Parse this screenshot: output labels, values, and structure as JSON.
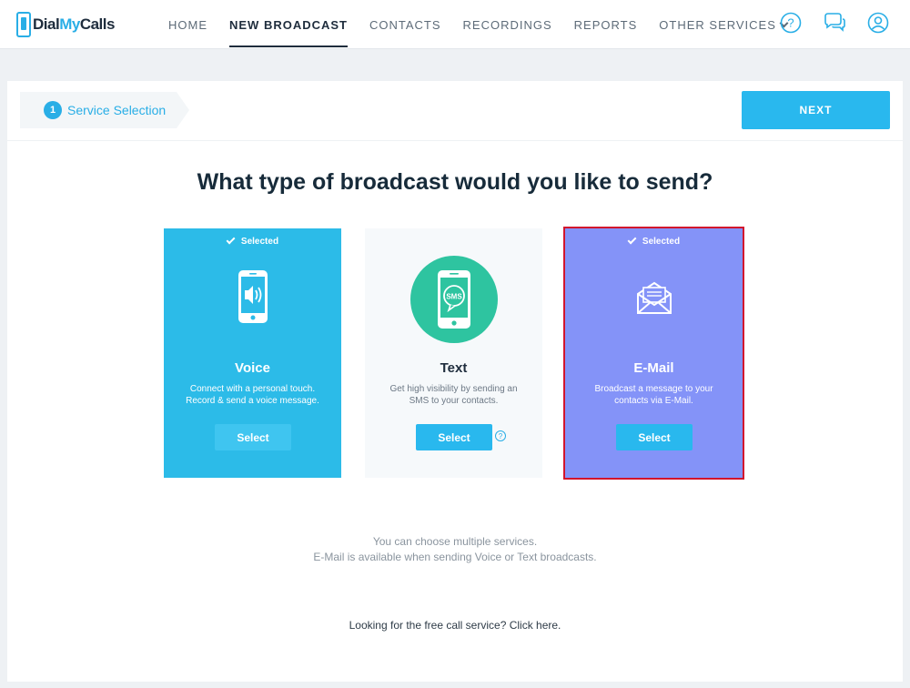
{
  "app": {
    "brand_prefix": "Dial",
    "brand_accent": "My",
    "brand_suffix": "Calls"
  },
  "nav": {
    "items": [
      {
        "label": "HOME",
        "active": false
      },
      {
        "label": "NEW BROADCAST",
        "active": true
      },
      {
        "label": "CONTACTS",
        "active": false
      },
      {
        "label": "RECORDINGS",
        "active": false
      },
      {
        "label": "REPORTS",
        "active": false
      },
      {
        "label": "OTHER SERVICES",
        "active": false
      }
    ],
    "icons": [
      "help-icon",
      "chat-icon",
      "account-icon"
    ]
  },
  "step": {
    "number": "1",
    "label": "Service Selection"
  },
  "next_button": "NEXT",
  "question": "What type of broadcast would you like to send?",
  "cards": [
    {
      "key": "voice",
      "selected_label": "Selected",
      "title": "Voice",
      "desc_line1": "Connect with a personal touch.",
      "desc_line2": "Record & send a voice message.",
      "button": "Select"
    },
    {
      "key": "text",
      "selected_label": "",
      "title": "Text",
      "desc_line1": "Get high visibility by sending an",
      "desc_line2": "SMS to your contacts.",
      "button": "Select",
      "icon_text": "SMS",
      "help": "?"
    },
    {
      "key": "email",
      "selected_label": "Selected",
      "title": "E-Mail",
      "desc_line1": "Broadcast a message to your",
      "desc_line2": "contacts via E-Mail.",
      "button": "Select"
    }
  ],
  "notes": {
    "line1": "You can choose multiple services.",
    "line2": "E-Mail is available when sending Voice or Text broadcasts."
  },
  "free_link": "Looking for the free call service? Click here.",
  "colors": {
    "accent": "#29aee6",
    "voice_card": "#2cbbe8",
    "email_card": "#8493f8",
    "text_icon_circle": "#2ec4a0",
    "highlight_border": "#d2152d"
  }
}
